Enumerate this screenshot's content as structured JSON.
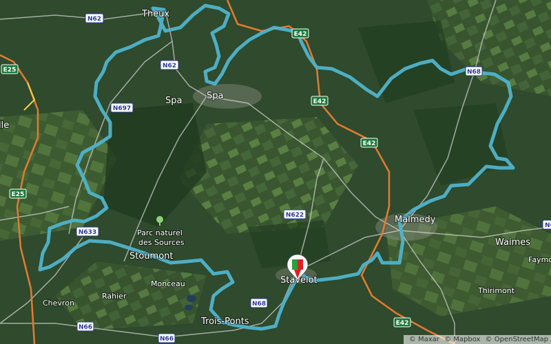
{
  "map": {
    "style": "satellite",
    "colors": {
      "terrain": "#2f4a2c",
      "field": "#4d6a3a",
      "forest": "#1f3a1e",
      "motorway": "#e07a33",
      "road": "#cfcfcf",
      "route": "#4fb3cc",
      "e_shield": "#1a7a3a",
      "n_shield": "#ffffff",
      "n_shield_text": "#2a3a9a",
      "marker_green": "#2e9e3e",
      "marker_red": "#e02020"
    },
    "places": [
      {
        "name": "Theux"
      },
      {
        "name": "Spa"
      },
      {
        "name": "Malmedy"
      },
      {
        "name": "Waimes"
      },
      {
        "name": "Faymo"
      },
      {
        "name": "Stavelot"
      },
      {
        "name": "Stoumont"
      },
      {
        "name": "Monceau"
      },
      {
        "name": "Rahier"
      },
      {
        "name": "Chevron"
      },
      {
        "name": "Trois-Ponts"
      },
      {
        "name": "Thirimont"
      },
      {
        "name": "lle"
      }
    ],
    "park": {
      "line1": "Parc naturel",
      "line2": "des Sources",
      "icon": "tree-icon"
    },
    "roads": [
      "N62",
      "N62",
      "E25",
      "N697",
      "E42",
      "N68",
      "E42",
      "E42",
      "E25",
      "N633",
      "N622",
      "N68",
      "N66",
      "N66",
      "E42",
      "N6"
    ],
    "marker": {
      "icon": "start-finish-flag-icon"
    },
    "attribution": [
      "© Maxar",
      "© Mapbox",
      "© OpenStreetMap"
    ]
  }
}
